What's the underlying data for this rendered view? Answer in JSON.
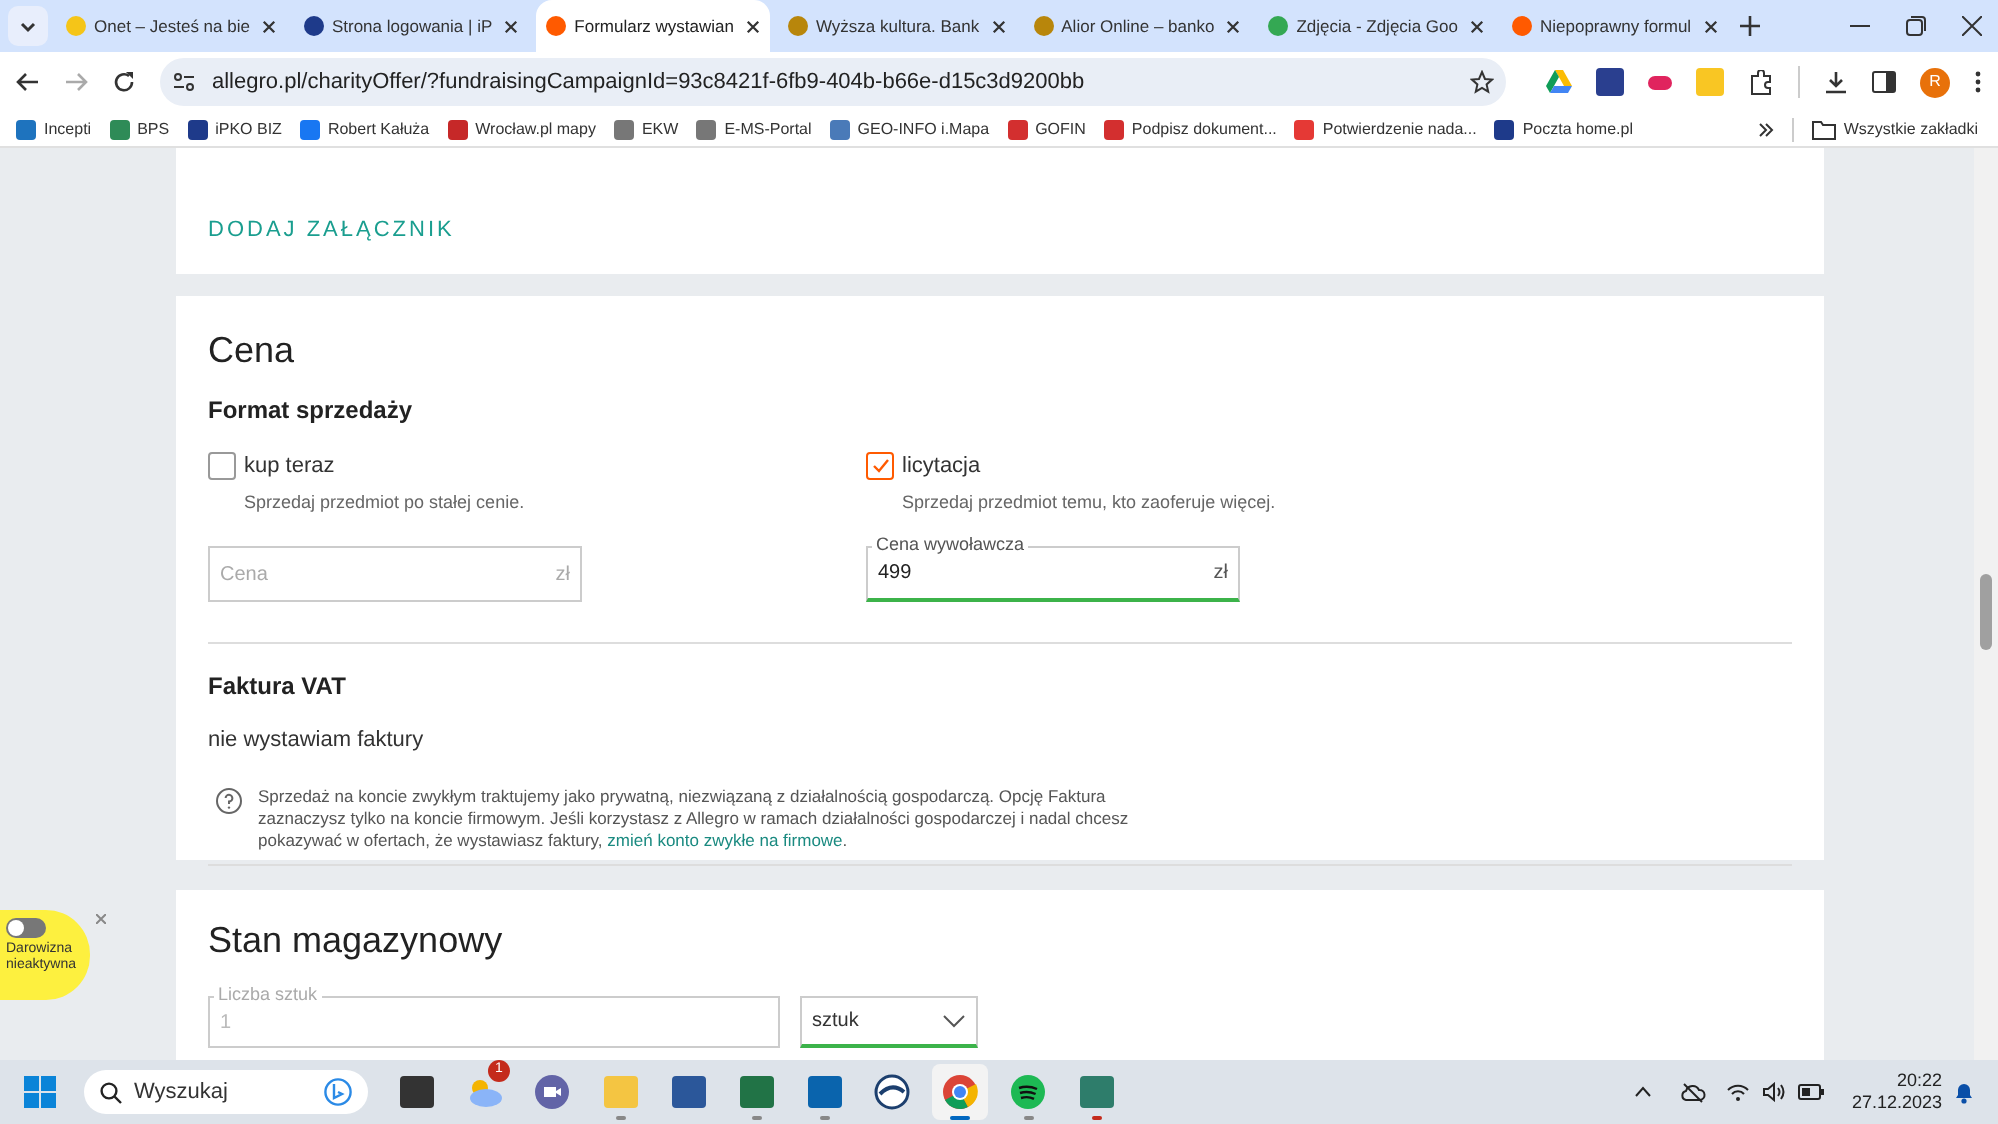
{
  "browser": {
    "tabs": [
      {
        "title": "Onet – Jesteś na bie",
        "selected": false,
        "color": "#f5c518"
      },
      {
        "title": "Strona logowania | iP",
        "selected": false,
        "color": "#1e3a8a"
      },
      {
        "title": "Formularz wystawian",
        "selected": true,
        "color": "#ff5a00"
      },
      {
        "title": "Wyższa kultura. Bank",
        "selected": false,
        "color": "#b8860b"
      },
      {
        "title": "Alior Online – banko",
        "selected": false,
        "color": "#b8860b"
      },
      {
        "title": "Zdjęcia - Zdjęcia Goo",
        "selected": false,
        "color": "#34a853"
      },
      {
        "title": "Niepoprawny formul",
        "selected": false,
        "color": "#ff5a00"
      }
    ],
    "url": "allegro.pl/charityOffer/?fundraisingCampaignId=93c8421f-6fb9-404b-b66e-d15c3d9200bb",
    "profile": "R",
    "bookmarks": [
      {
        "label": "Incepti",
        "color": "#1e73be"
      },
      {
        "label": "BPS",
        "color": "#2e8b57"
      },
      {
        "label": "iPKO BIZ",
        "color": "#1e3a8a"
      },
      {
        "label": "Robert Kałuża",
        "color": "#1877f2"
      },
      {
        "label": "Wrocław.pl mapy",
        "color": "#c62828"
      },
      {
        "label": "EKW",
        "color": "#777777"
      },
      {
        "label": "E-MS-Portal",
        "color": "#777777"
      },
      {
        "label": "GEO-INFO i.Mapa",
        "color": "#4a7ab8"
      },
      {
        "label": "GOFIN",
        "color": "#d32f2f"
      },
      {
        "label": "Podpisz dokument...",
        "color": "#d32f2f"
      },
      {
        "label": "Potwierdzenie nada...",
        "color": "#e53935"
      },
      {
        "label": "Poczta home.pl",
        "color": "#1e3a8a"
      }
    ],
    "all_bookmarks": "Wszystkie zakładki"
  },
  "attachments": {
    "button": "DODAJ ZAŁĄCZNIK"
  },
  "price": {
    "title": "Cena",
    "format_title": "Format sprzedaży",
    "options": [
      {
        "label": "kup teraz",
        "hint": "Sprzedaj przedmiot po stałej cenie.",
        "checked": false,
        "field": {
          "placeholder": "Cena",
          "unit": "zł"
        }
      },
      {
        "label": "licytacja",
        "hint": "Sprzedaj przedmiot temu, kto zaoferuje więcej.",
        "checked": true,
        "field": {
          "label": "Cena wywoławcza",
          "value": "499",
          "unit": "zł"
        }
      }
    ],
    "invoice_title": "Faktura VAT",
    "invoice_value": "nie wystawiam faktury",
    "invoice_info": "Sprzedaż na koncie zwykłym traktujemy jako prywatną, niezwiązaną z działalnością gospodarczą. Opcję Faktura zaznaczysz tylko na koncie firmowym. Jeśli korzystasz z Allegro w ramach działalności gospodarczej i nadal chcesz pokazywać w ofertach, że wystawiasz faktury,",
    "invoice_link": "zmień konto zwykłe na firmowe",
    "invoice_end": "."
  },
  "stock": {
    "title": "Stan magazynowy",
    "field": {
      "label": "Liczba sztuk",
      "value": "1",
      "disabled": true
    },
    "unit_select": "sztuk"
  },
  "donation_widget": {
    "label": "Darowizna nieaktywna",
    "on": false
  },
  "taskbar": {
    "search": "Wyszukaj",
    "weather_badge": "1",
    "apps": [
      {
        "kind": "task",
        "open": false
      },
      {
        "kind": "weather",
        "open": false
      },
      {
        "kind": "meet",
        "open": false
      },
      {
        "kind": "files",
        "open": true
      },
      {
        "kind": "word",
        "open": false
      },
      {
        "kind": "excel",
        "open": true
      },
      {
        "kind": "outlook",
        "open": true
      },
      {
        "kind": "globe",
        "open": false
      },
      {
        "kind": "chrome",
        "open": true
      },
      {
        "kind": "spotify",
        "open": true
      },
      {
        "kind": "maps",
        "open": true
      }
    ],
    "time": "20:22",
    "date": "27.12.2023"
  }
}
